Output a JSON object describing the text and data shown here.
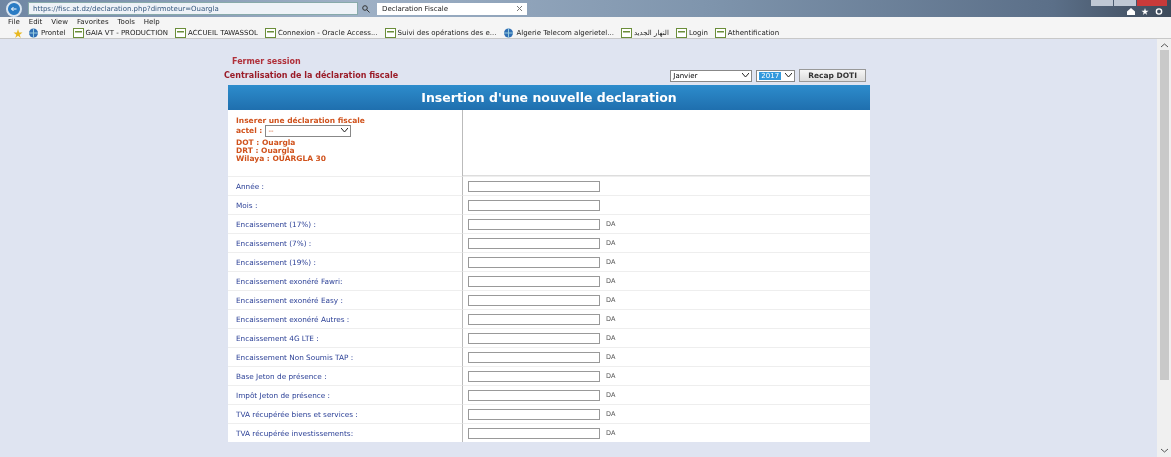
{
  "window": {
    "url": "https://fisc.at.dz/declaration.php?dirmoteur=Ouargla",
    "tab_title": "Declaration Fiscale"
  },
  "menu": [
    "File",
    "Edit",
    "View",
    "Favorites",
    "Tools",
    "Help"
  ],
  "favorites": [
    {
      "label": "Prontel",
      "kind": "globe"
    },
    {
      "label": "GAIA VT - PRODUCTION",
      "kind": "page"
    },
    {
      "label": "ACCUEIL TAWASSOL",
      "kind": "page"
    },
    {
      "label": "Connexion - Oracle Access...",
      "kind": "page"
    },
    {
      "label": "Suivi des opérations des e...",
      "kind": "page"
    },
    {
      "label": "Algerie Telecom algerietel...",
      "kind": "globe"
    },
    {
      "label": "النهار الجديد",
      "kind": "page"
    },
    {
      "label": "Login",
      "kind": "page"
    },
    {
      "label": "Athentification",
      "kind": "page"
    }
  ],
  "page": {
    "logout_link": "Fermer session",
    "heading": "Centralisation de la déclaration fiscale",
    "month": "Janvier",
    "year": "2017",
    "recap_button": "Recap DOTI"
  },
  "form": {
    "title": "Insertion d'une nouvelle declaration",
    "info": {
      "title": "Inserer une déclaration fiscale",
      "actel_label": "actel :",
      "actel_value": "--",
      "lines": [
        "DOT : Ouargla",
        "DRT : Ouargla",
        "Wilaya : OUARGLA 30"
      ]
    },
    "fields": [
      {
        "label": "Année :"
      },
      {
        "label": "Mois :"
      },
      {
        "label": "Encaissement (17%) :",
        "unit": "DA"
      },
      {
        "label": "Encaissement (7%) :",
        "unit": "DA"
      },
      {
        "label": "Encaissement (19%) :",
        "unit": "DA"
      },
      {
        "label": "Encaissement exonéré Fawri:",
        "unit": "DA"
      },
      {
        "label": "Encaissement exonéré Easy :",
        "unit": "DA"
      },
      {
        "label": "Encaissement exonéré Autres :",
        "unit": "DA"
      },
      {
        "label": "Encaissement 4G LTE :",
        "unit": "DA"
      },
      {
        "label": "Encaissement Non Soumis TAP :",
        "unit": "DA"
      },
      {
        "label": "Base Jeton de présence :",
        "unit": "DA"
      },
      {
        "label": "Impôt Jeton de présence :",
        "unit": "DA"
      },
      {
        "label": "TVA récupérée biens et services :",
        "unit": "DA"
      },
      {
        "label": "TVA récupérée investissements:",
        "unit": "DA"
      }
    ]
  }
}
